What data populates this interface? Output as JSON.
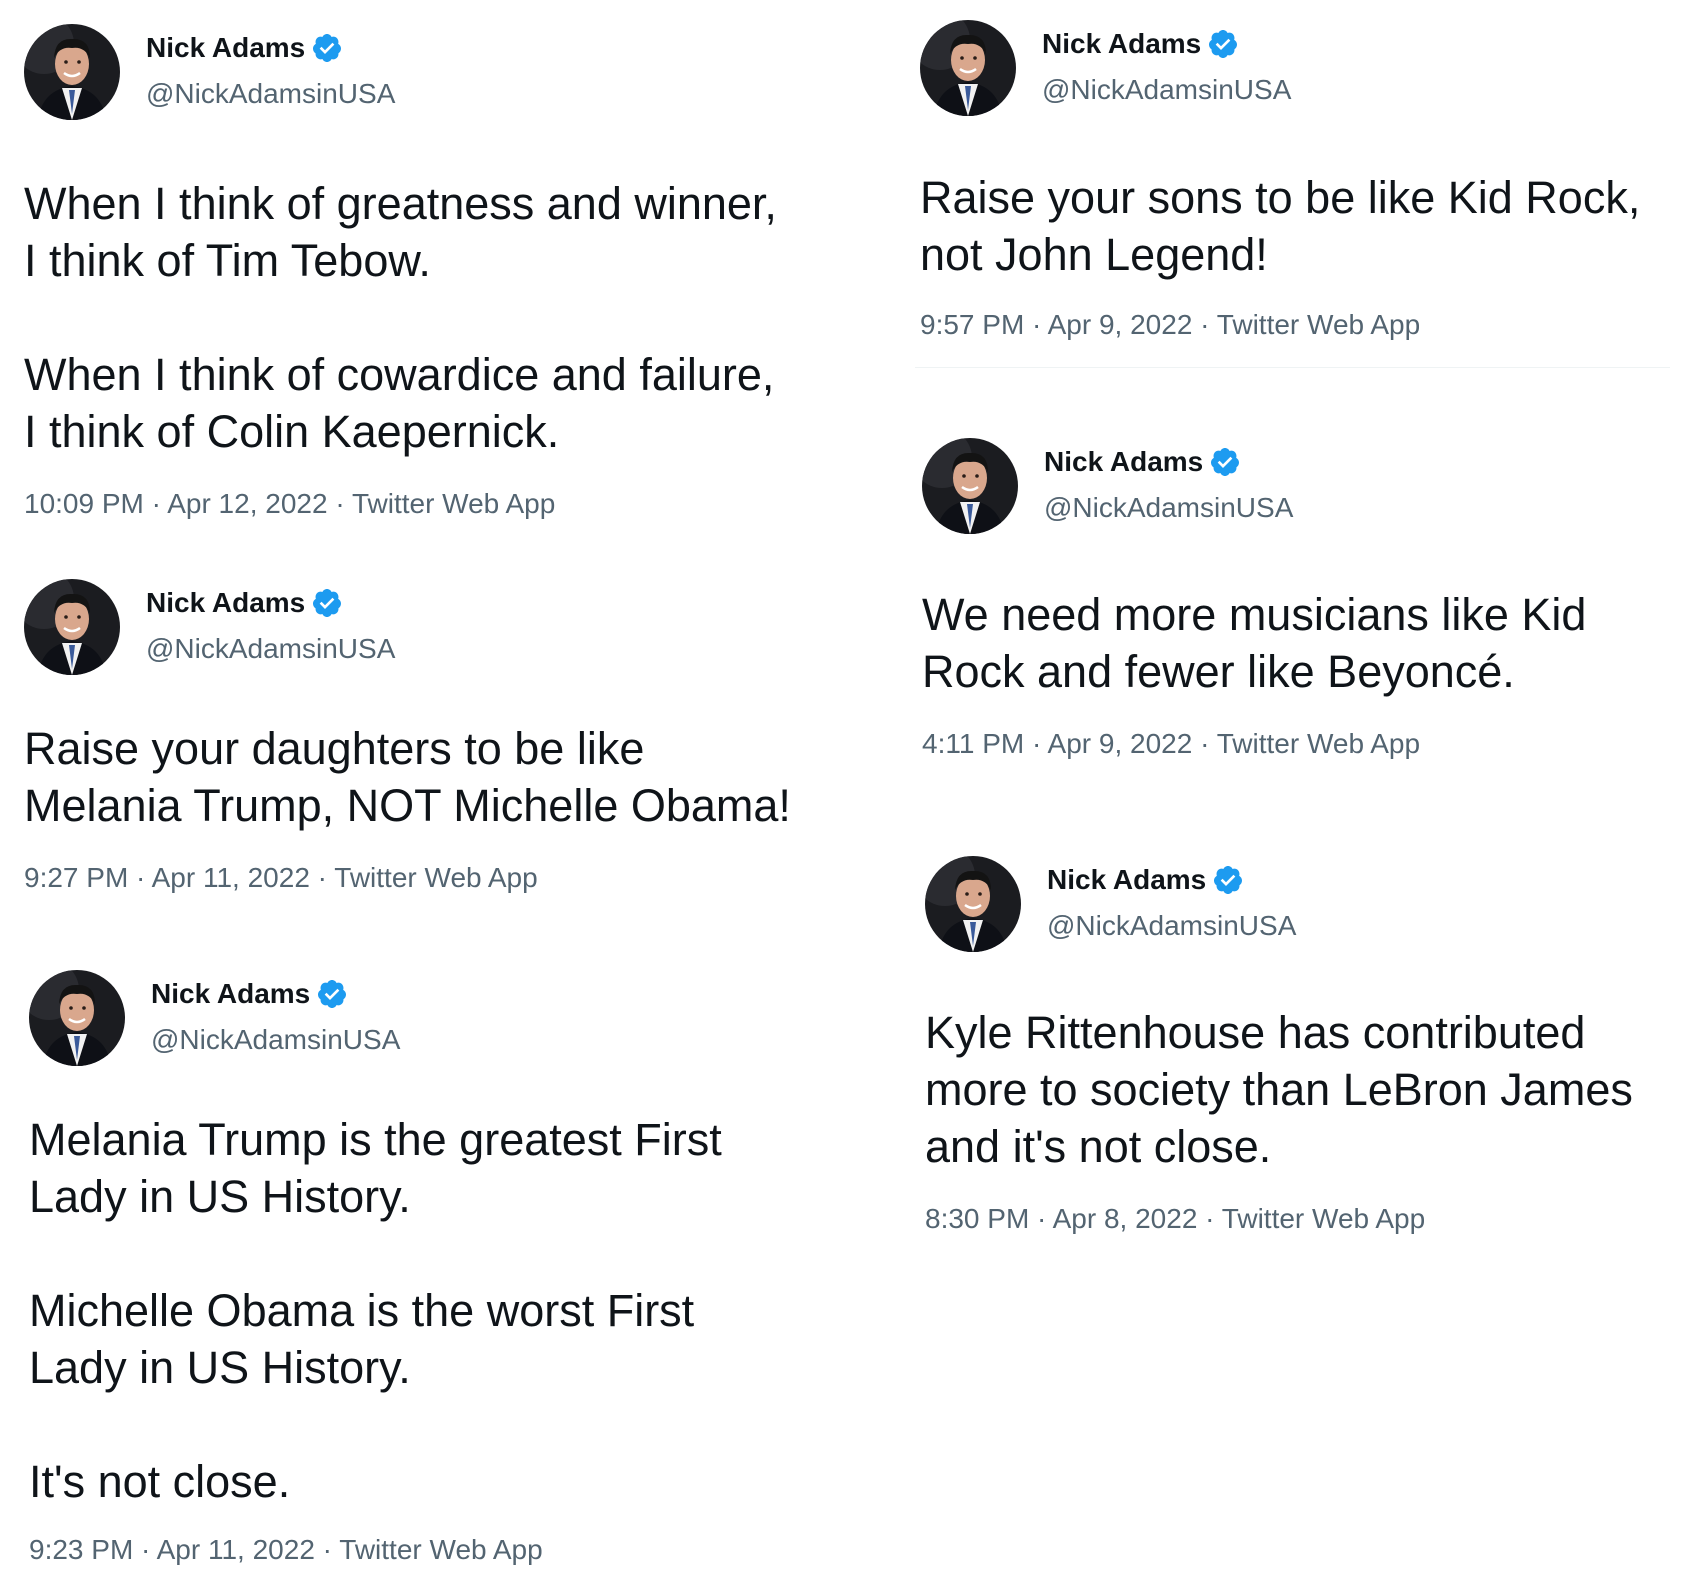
{
  "tweets": [
    {
      "name": "Nick Adams",
      "handle": "@NickAdamsinUSA",
      "text": "When I think of greatness and winner,\nI think of Tim Tebow.\n\nWhen I think of cowardice and failure,\nI think of Colin Kaepernick.",
      "time": "10:09 PM",
      "date": "Apr 12, 2022",
      "source": "Twitter Web App"
    },
    {
      "name": "Nick Adams",
      "handle": "@NickAdamsinUSA",
      "text": "Raise your daughters to be like\nMelania Trump, NOT Michelle Obama!",
      "time": "9:27 PM",
      "date": "Apr 11, 2022",
      "source": "Twitter Web App"
    },
    {
      "name": "Nick Adams",
      "handle": "@NickAdamsinUSA",
      "text": "Melania Trump is the greatest First\nLady in US History.\n\nMichelle Obama is the worst First\nLady in US History.\n\nIt's not close.",
      "time": "9:23 PM",
      "date": "Apr 11, 2022",
      "source": "Twitter Web App"
    },
    {
      "name": "Nick Adams",
      "handle": "@NickAdamsinUSA",
      "text": "Raise your sons to be like Kid Rock,\nnot John Legend!",
      "time": "9:57 PM",
      "date": "Apr 9, 2022",
      "source": "Twitter Web App"
    },
    {
      "name": "Nick Adams",
      "handle": "@NickAdamsinUSA",
      "text": "We need more musicians like Kid\nRock and fewer like Beyoncé.",
      "time": "4:11 PM",
      "date": "Apr 9, 2022",
      "source": "Twitter Web App"
    },
    {
      "name": "Nick Adams",
      "handle": "@NickAdamsinUSA",
      "text": "Kyle Rittenhouse has contributed\nmore to society than LeBron James\nand it's not close.",
      "time": "8:30 PM",
      "date": "Apr 8, 2022",
      "source": "Twitter Web App"
    }
  ],
  "separator": " · ",
  "colors": {
    "text": "#0f1419",
    "secondary": "#536471",
    "verified_badge": "#1d9bf0",
    "divider": "#eff3f4"
  },
  "icons": {
    "verified": "verified-badge-icon",
    "avatar": "profile-photo"
  }
}
